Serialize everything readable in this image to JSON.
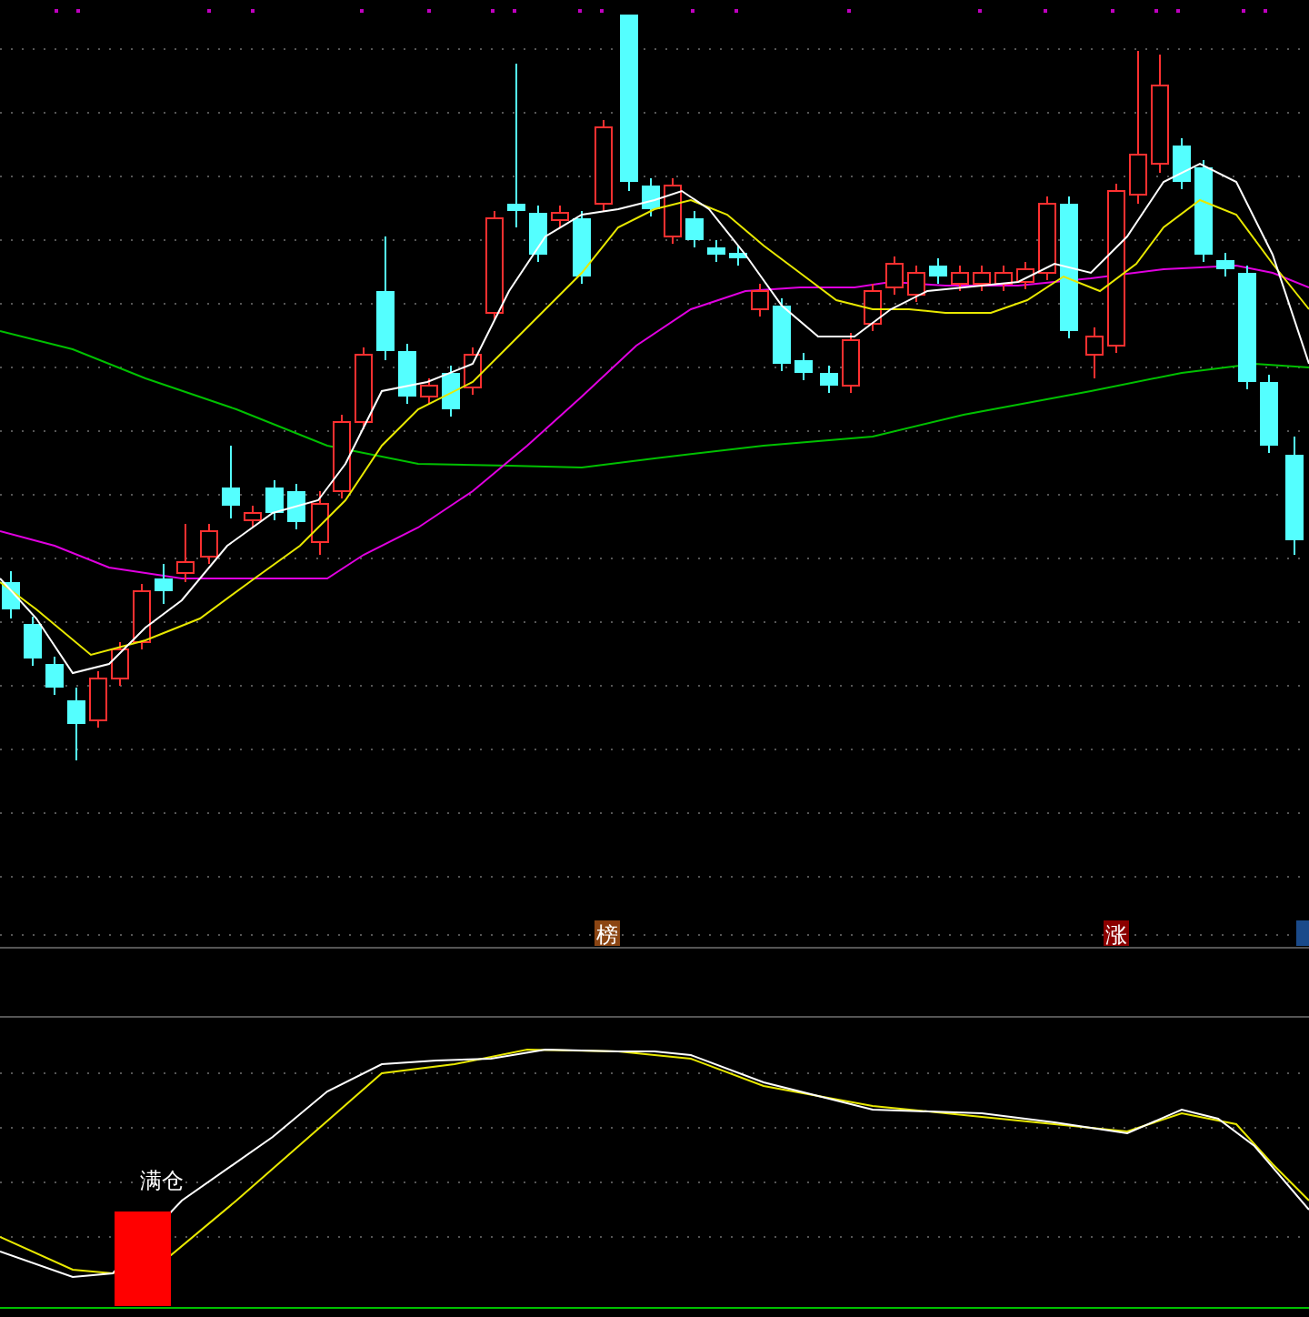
{
  "markers": [
    {
      "text": "榜",
      "color": "#8b4513"
    },
    {
      "text": "涨",
      "color": "#8b0000"
    }
  ],
  "signal": {
    "label": "满仓"
  }
}
